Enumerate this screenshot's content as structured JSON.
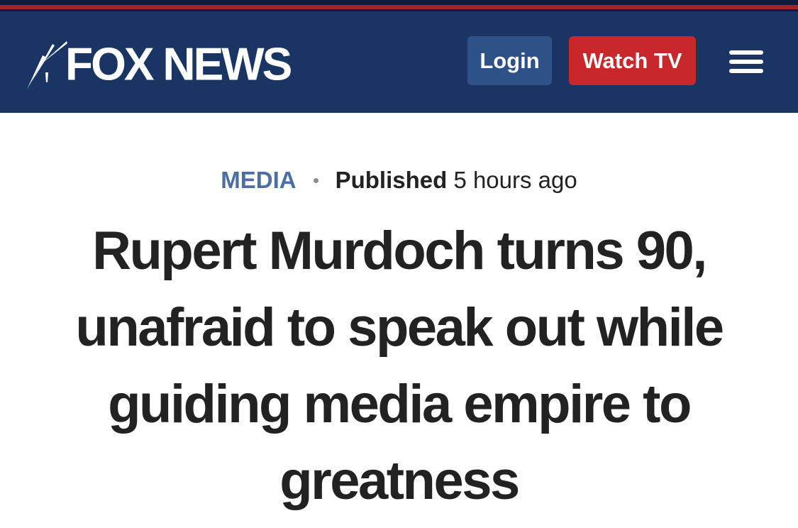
{
  "header": {
    "logo_text": "FOX NEWS",
    "login_label": "Login",
    "watch_tv_label": "Watch TV",
    "menu_icon": "hamburger-menu-icon",
    "logo_icon": "fox-searchlight-icon"
  },
  "article": {
    "category": "MEDIA",
    "published_label": "Published",
    "published_time": "5 hours ago",
    "headline": "Rupert Murdoch turns 90, unafraid to speak out while guiding media empire to greatness"
  },
  "colors": {
    "header_bg": "#1a3564",
    "top_stripe_red": "#a8222b",
    "login_bg": "#2e5287",
    "watch_tv_bg": "#c8282c",
    "category_color": "#4a6fa5",
    "headline_color": "#222222"
  }
}
